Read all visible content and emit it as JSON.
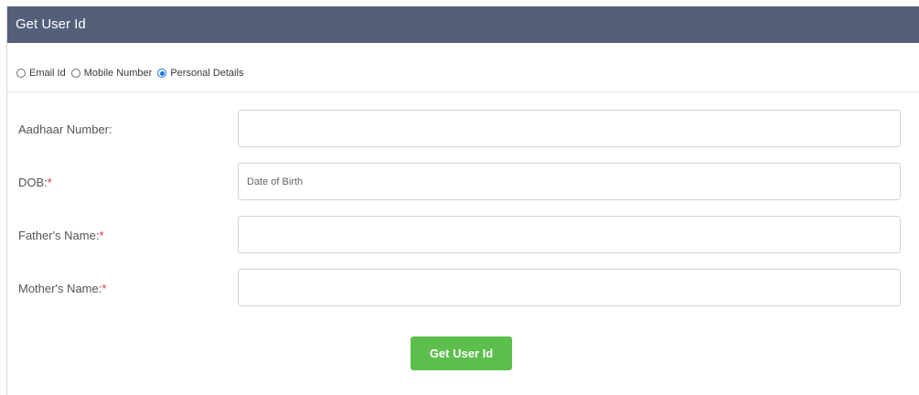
{
  "header": {
    "title": "Get User Id"
  },
  "radio_options": [
    {
      "label": "Email Id",
      "checked": false
    },
    {
      "label": "Mobile Number",
      "checked": false
    },
    {
      "label": "Personal Details",
      "checked": true
    }
  ],
  "fields": {
    "aadhaar": {
      "label": "Aadhaar Number:",
      "required": "",
      "placeholder": "",
      "value": ""
    },
    "dob": {
      "label": "DOB:",
      "required": "*",
      "placeholder": "Date of Birth",
      "value": ""
    },
    "father": {
      "label": "Father's Name:",
      "required": "*",
      "placeholder": "",
      "value": ""
    },
    "mother": {
      "label": "Mother's Name:",
      "required": "*",
      "placeholder": "",
      "value": ""
    }
  },
  "submit": {
    "label": "Get User Id"
  },
  "colors": {
    "header_bg": "#545f7a",
    "button_bg": "#5cbf4c",
    "required": "#e03131",
    "radio_accent": "#1a73e8"
  }
}
